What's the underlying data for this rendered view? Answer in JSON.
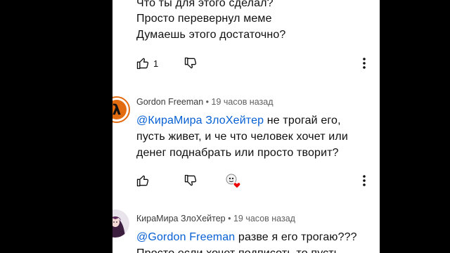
{
  "comments": [
    {
      "lines": [
        "Что ты для этого сделал?",
        "Просто перевернул меме",
        "Думаешь этого достаточно?"
      ],
      "likes": "1"
    },
    {
      "author": "Gordon Freeman",
      "time": " • 19 часов назад",
      "mention": "@КираМира ЗлоХейтер",
      "line1_rest": " не трогай его,",
      "line2": "пусть живет, и че что человек хочет или",
      "line3": "денег поднабрать или просто творит?",
      "avatar_glyph": "λ"
    },
    {
      "author": "КираМира ЗлоХейтер",
      "time": " • 19 часов назад",
      "mention": "@Gordon Freeman",
      "line1_rest": " разве я его трогаю???",
      "line2": "Просто если хочет подписоть то пусть"
    }
  ],
  "colors": {
    "mention": "#065fd4",
    "text": "#0f0f0f",
    "meta": "#606060",
    "gordon_avatar": "#e36b0f"
  },
  "icons": [
    "like-icon",
    "dislike-icon",
    "more-vert-icon",
    "creator-heart-icon",
    "half-life-lambda-icon"
  ]
}
